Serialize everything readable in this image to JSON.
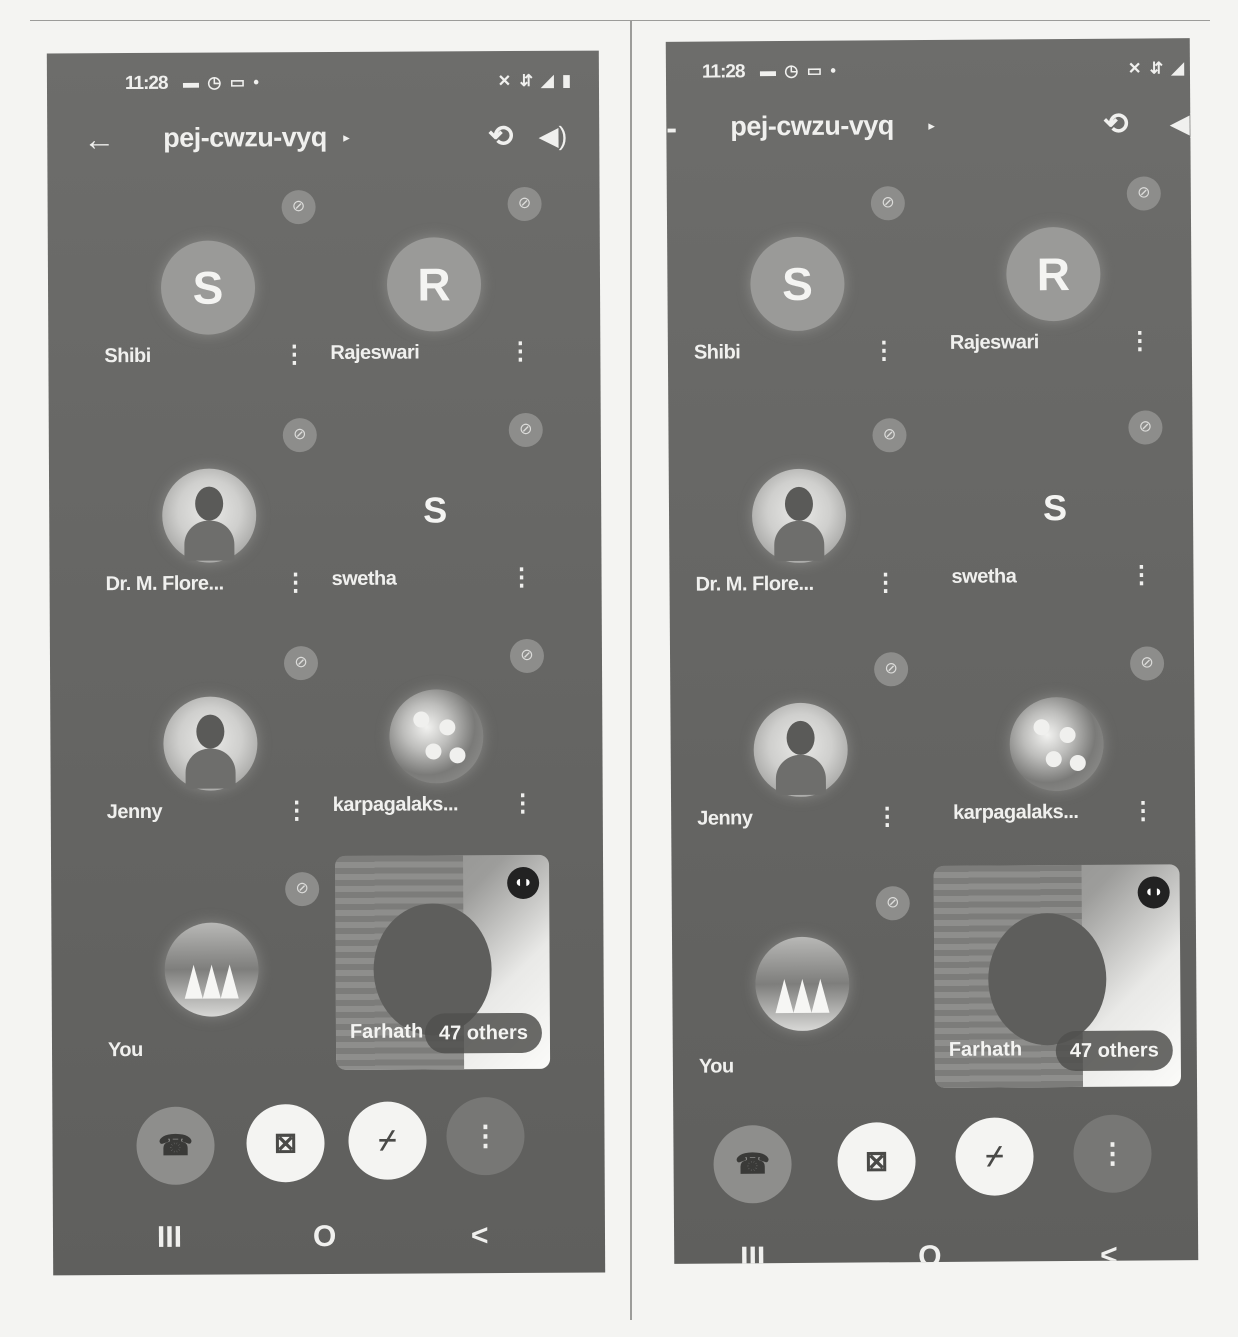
{
  "screens": [
    {
      "status": {
        "time": "11:28",
        "notif": "▬ ◷ ▭ •",
        "sys": "✕ ⇵ ◢ ▮"
      },
      "topbar": {
        "back": "←",
        "title": "pej-cwzu-vyq",
        "caret": "▸",
        "switch_cam": "⟲",
        "speaker": "◀)"
      },
      "participants": [
        {
          "name": "Shibi",
          "initial": "S"
        },
        {
          "name": "Rajeswari",
          "initial": "R"
        },
        {
          "name": "Dr. M. Flore...",
          "initial": ""
        },
        {
          "name": "swetha",
          "initial": "S"
        },
        {
          "name": "Jenny",
          "initial": ""
        },
        {
          "name": "karpagalaks...",
          "initial": ""
        },
        {
          "name": "You",
          "initial": ""
        }
      ],
      "video": {
        "name": "Farhath",
        "others": "47 others",
        "speaking": "◖◗"
      },
      "controls": {
        "end": "☎",
        "camera": "⊠",
        "mic": "⌿",
        "more": "⋮"
      },
      "nav": {
        "recents": "III",
        "home": "O",
        "back": "<"
      },
      "mute_glyph": "⊘",
      "more_glyph": "⋮"
    },
    {
      "status": {
        "time": "11:28",
        "notif": "▬ ◷ ▭ •",
        "sys": "✕ ⇵ ◢"
      },
      "topbar": {
        "back": "-",
        "title": "pej-cwzu-vyq",
        "caret": "▸",
        "switch_cam": "⟲",
        "speaker": "◀)"
      },
      "participants": [
        {
          "name": "Shibi",
          "initial": "S"
        },
        {
          "name": "Rajeswari",
          "initial": "R"
        },
        {
          "name": "Dr. M. Flore...",
          "initial": ""
        },
        {
          "name": "swetha",
          "initial": "S"
        },
        {
          "name": "Jenny",
          "initial": ""
        },
        {
          "name": "karpagalaks...",
          "initial": ""
        },
        {
          "name": "You",
          "initial": ""
        }
      ],
      "video": {
        "name": "Farhath",
        "others": "47 others",
        "speaking": "◖◗"
      },
      "controls": {
        "end": "☎",
        "camera": "⊠",
        "mic": "⌿",
        "more": "⋮"
      },
      "nav": {
        "recents": "III",
        "home": "O",
        "back": "<"
      },
      "mute_glyph": "⊘",
      "more_glyph": "⋮"
    }
  ]
}
